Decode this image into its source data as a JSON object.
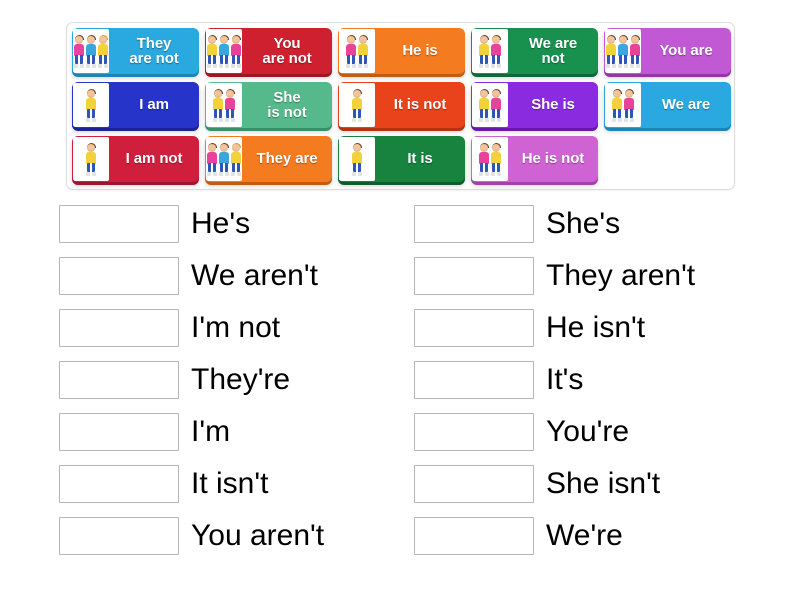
{
  "activity": {
    "type": "match-up",
    "tray": {
      "rows": [
        [
          {
            "label": "They are not",
            "lines": [
              "They",
              "are not"
            ],
            "color": "#29a9e0",
            "shadow": "#1b86b5",
            "figures": [
              {
                "shirt": "#e8439b",
                "legs": "#2f56b5",
                "hair": "#6b4226"
              },
              {
                "shirt": "#3aa6e0",
                "legs": "#2f56b5",
                "hair": "#6b4226"
              },
              {
                "shirt": "#f2d13b",
                "legs": "#2f56b5",
                "hair": "#d8a13a"
              }
            ]
          },
          {
            "label": "You are not",
            "lines": [
              "You",
              "are not"
            ],
            "color": "#cf202f",
            "shadow": "#9d1723",
            "figures": [
              {
                "shirt": "#f2d13b",
                "legs": "#2f56b5",
                "hair": "#6b4226"
              },
              {
                "shirt": "#3aa6e0",
                "legs": "#2f56b5",
                "hair": "#6b4226"
              },
              {
                "shirt": "#e8439b",
                "legs": "#2f56b5",
                "hair": "#6b4226"
              }
            ]
          },
          {
            "label": "He is",
            "lines": [
              "He is"
            ],
            "color": "#f47b20",
            "shadow": "#c25c10",
            "figures": [
              {
                "shirt": "#e8439b",
                "legs": "#2f56b5",
                "hair": "#6b4226"
              },
              {
                "shirt": "#f2d13b",
                "legs": "#2f56b5",
                "hair": "#6b4226"
              }
            ]
          },
          {
            "label": "We are not",
            "lines": [
              "We are",
              "not"
            ],
            "color": "#18914e",
            "shadow": "#10683a",
            "figures": [
              {
                "shirt": "#f2d13b",
                "legs": "#2f56b5",
                "hair": "#6b4226"
              },
              {
                "shirt": "#e8439b",
                "legs": "#2f56b5",
                "hair": "#6b4226"
              }
            ]
          },
          {
            "label": "You are",
            "lines": [
              "You are"
            ],
            "color": "#c159d4",
            "shadow": "#9337a6",
            "figures": [
              {
                "shirt": "#f2d13b",
                "legs": "#2f56b5",
                "hair": "#6b4226"
              },
              {
                "shirt": "#3aa6e0",
                "legs": "#2f56b5",
                "hair": "#6b4226"
              },
              {
                "shirt": "#e8439b",
                "legs": "#2f56b5",
                "hair": "#6b4226"
              }
            ]
          }
        ],
        [
          {
            "label": "I am",
            "lines": [
              "I am"
            ],
            "color": "#2634c9",
            "shadow": "#1a2494",
            "figures": [
              {
                "shirt": "#f2d13b",
                "legs": "#2f56b5",
                "hair": "#6b4226"
              }
            ]
          },
          {
            "label": "She is not",
            "lines": [
              "She",
              "is not"
            ],
            "color": "#55b98c",
            "shadow": "#3b8e68",
            "figures": [
              {
                "shirt": "#f2d13b",
                "legs": "#2f56b5",
                "hair": "#6b4226"
              },
              {
                "shirt": "#e8439b",
                "legs": "#2f56b5",
                "hair": "#6b4226"
              }
            ]
          },
          {
            "label": "It is not",
            "lines": [
              "It is not"
            ],
            "color": "#e8431a",
            "shadow": "#b33212",
            "figures": [
              {
                "shirt": "#f2d13b",
                "legs": "#2f56b5",
                "hair": "#6b4226"
              }
            ]
          },
          {
            "label": "She is",
            "lines": [
              "She is"
            ],
            "color": "#8a2be0",
            "shadow": "#6518ab",
            "figures": [
              {
                "shirt": "#f2d13b",
                "legs": "#2f56b5",
                "hair": "#6b4226"
              },
              {
                "shirt": "#e8439b",
                "legs": "#2f56b5",
                "hair": "#6b4226"
              }
            ]
          },
          {
            "label": "We are",
            "lines": [
              "We are"
            ],
            "color": "#29a9e0",
            "shadow": "#1b86b5",
            "figures": [
              {
                "shirt": "#f2d13b",
                "legs": "#2f56b5",
                "hair": "#6b4226"
              },
              {
                "shirt": "#e8439b",
                "legs": "#2f56b5",
                "hair": "#6b4226"
              }
            ]
          }
        ],
        [
          {
            "label": "I am not",
            "lines": [
              "I am not"
            ],
            "color": "#cf1f3c",
            "shadow": "#9b1730",
            "figures": [
              {
                "shirt": "#f2d13b",
                "legs": "#2f56b5",
                "hair": "#6b4226"
              }
            ]
          },
          {
            "label": "They are",
            "lines": [
              "They are"
            ],
            "color": "#f47b20",
            "shadow": "#c25c10",
            "figures": [
              {
                "shirt": "#e8439b",
                "legs": "#2f56b5",
                "hair": "#6b4226"
              },
              {
                "shirt": "#3aa6e0",
                "legs": "#2f56b5",
                "hair": "#6b4226"
              },
              {
                "shirt": "#f2d13b",
                "legs": "#2f56b5",
                "hair": "#d8a13a"
              }
            ]
          },
          {
            "label": "It is",
            "lines": [
              "It is"
            ],
            "color": "#17833f",
            "shadow": "#0f5b2b",
            "figures": [
              {
                "shirt": "#f2d13b",
                "legs": "#2f56b5",
                "hair": "#6b4226"
              }
            ]
          },
          {
            "label": "He is not",
            "lines": [
              "He is not"
            ],
            "color": "#cf63d4",
            "shadow": "#a241a8",
            "figures": [
              {
                "shirt": "#e8439b",
                "legs": "#2f56b5",
                "hair": "#6b4226"
              },
              {
                "shirt": "#f2d13b",
                "legs": "#2f56b5",
                "hair": "#6b4226"
              }
            ]
          }
        ]
      ]
    },
    "answers": {
      "left": [
        {
          "prompt": "He's",
          "box_value": ""
        },
        {
          "prompt": "We aren't",
          "box_value": ""
        },
        {
          "prompt": "I'm not",
          "box_value": ""
        },
        {
          "prompt": "They're",
          "box_value": ""
        },
        {
          "prompt": "I'm",
          "box_value": ""
        },
        {
          "prompt": "It isn't",
          "box_value": ""
        },
        {
          "prompt": "You aren't",
          "box_value": ""
        }
      ],
      "right": [
        {
          "prompt": "She's",
          "box_value": ""
        },
        {
          "prompt": "They aren't",
          "box_value": ""
        },
        {
          "prompt": "He isn't",
          "box_value": ""
        },
        {
          "prompt": "It's",
          "box_value": ""
        },
        {
          "prompt": "You're",
          "box_value": ""
        },
        {
          "prompt": "She isn't",
          "box_value": ""
        },
        {
          "prompt": "We're",
          "box_value": ""
        }
      ]
    }
  },
  "colors": {
    "page_background": "#ffffff",
    "tray_border": "#dcdcdc",
    "drop_box_border": "#b5b5b5",
    "prompt_text": "#000000",
    "tile_text": "#ffffff"
  }
}
